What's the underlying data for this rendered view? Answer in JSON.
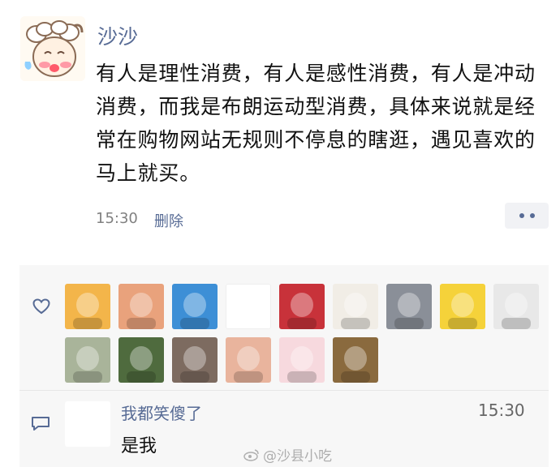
{
  "post": {
    "author": "沙沙",
    "body": "有人是理性消费，有人是感性消费，有人是冲动消费，而我是布朗运动型消费，具体来说就是经常在购物网站无规则不停息的瞎逛，遇见喜欢的马上就买。",
    "time": "15:30",
    "delete_label": "删除"
  },
  "likes": {
    "icon": "heart-icon",
    "avatars": [
      {
        "name": "liker-avatar-masked-man",
        "bg": "#f3b54a"
      },
      {
        "name": "liker-avatar-boy-sunset",
        "bg": "#e9a27c"
      },
      {
        "name": "liker-avatar-spongebob",
        "bg": "#3d8fd6"
      },
      {
        "name": "liker-avatar-blank",
        "bg": "#ffffff"
      },
      {
        "name": "liker-avatar-girl-red-hat",
        "bg": "#c8323a"
      },
      {
        "name": "liker-avatar-sketch-boy",
        "bg": "#f1ede6"
      },
      {
        "name": "liker-avatar-kakashi",
        "bg": "#8a8f98"
      },
      {
        "name": "liker-avatar-yellow-dino",
        "bg": "#f5d23a"
      },
      {
        "name": "liker-avatar-hooded-figure",
        "bg": "#e8e8e8"
      },
      {
        "name": "liker-avatar-white-horse",
        "bg": "#a9b49a"
      },
      {
        "name": "liker-avatar-panda",
        "bg": "#4f6b3e"
      },
      {
        "name": "liker-avatar-pig",
        "bg": "#7d6b60"
      },
      {
        "name": "liker-avatar-girl-phone",
        "bg": "#e9b49d"
      },
      {
        "name": "liker-avatar-anime-girl",
        "bg": "#f7d9de"
      },
      {
        "name": "liker-avatar-tiger",
        "bg": "#8a6a3e"
      }
    ]
  },
  "comment": {
    "icon": "comment-icon",
    "author": "我都笑傻了",
    "time": "15:30",
    "text": "是我"
  },
  "watermark": "@沙县小吃",
  "colors": {
    "link": "#576b95",
    "panel_bg": "#f7f7f7",
    "more_button_bg": "#f1f2f5"
  }
}
